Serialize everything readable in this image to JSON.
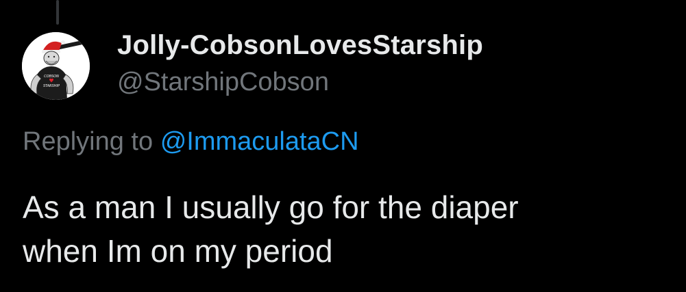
{
  "tweet": {
    "author": {
      "display_name": "Jolly-CobsonLovesStarship",
      "handle": "@StarshipCobson",
      "avatar": {
        "icon": "cartoon-man-santa-hat-avatar",
        "shirt_text_top": "COBSON",
        "shirt_text_bottom": "STARSHIP"
      }
    },
    "reply_context": {
      "prefix": "Replying to",
      "mention": "@ImmaculataCN"
    },
    "text_lines": [
      "As a man I usually go for the diaper",
      "when Im on my period"
    ]
  },
  "colors": {
    "background": "#000000",
    "primary_text": "#e7e9ea",
    "secondary_text": "#71767b",
    "link": "#1d9bf0",
    "thread_line": "#333639"
  }
}
